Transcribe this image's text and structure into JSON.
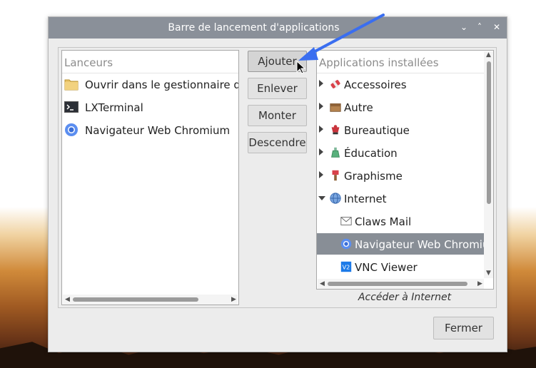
{
  "window": {
    "title": "Barre de lancement d'applications",
    "title_controls": [
      "⌄",
      "˄",
      "✕"
    ]
  },
  "launchers": {
    "header": "Lanceurs",
    "items": [
      {
        "label": "Ouvrir dans le gestionnaire de fichiers",
        "icon": "folder-icon"
      },
      {
        "label": "LXTerminal",
        "icon": "terminal-icon"
      },
      {
        "label": "Navigateur Web Chromium",
        "icon": "chromium-icon"
      }
    ]
  },
  "buttons": {
    "add": "Ajouter",
    "remove": "Enlever",
    "up": "Monter",
    "down": "Descendre"
  },
  "installed": {
    "header": "Applications installées",
    "categories": [
      {
        "label": "Accessoires",
        "icon": "accessories-icon",
        "expanded": false
      },
      {
        "label": "Autre",
        "icon": "other-icon",
        "expanded": false
      },
      {
        "label": "Bureautique",
        "icon": "office-icon",
        "expanded": false
      },
      {
        "label": "Éducation",
        "icon": "education-icon",
        "expanded": false
      },
      {
        "label": "Graphisme",
        "icon": "graphics-icon",
        "expanded": false
      },
      {
        "label": "Internet",
        "icon": "internet-icon",
        "expanded": true
      }
    ],
    "internet_children": [
      {
        "label": "Claws Mail",
        "icon": "mail-icon",
        "selected": false
      },
      {
        "label": "Navigateur Web Chromium",
        "icon": "chromium-icon",
        "selected": true
      },
      {
        "label": "VNC Viewer",
        "icon": "vnc-icon",
        "selected": false
      }
    ],
    "description": "Accéder à Internet"
  },
  "footer": {
    "close": "Fermer"
  },
  "colors": {
    "titlebar": "#8a9099",
    "selection": "#888e96",
    "annotation_arrow": "#3a6ef0"
  }
}
